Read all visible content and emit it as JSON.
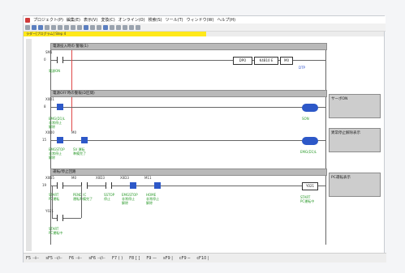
{
  "menubar": {
    "items": [
      "プロジェクト(P)",
      "編集(E)",
      "表示(V)",
      "変換(C)",
      "オンライン(O)",
      "検索(S)",
      "ツール(T)",
      "ウィンドウ(W)",
      "ヘルプ(H)"
    ]
  },
  "tab": {
    "label": "ラダー[プログラム] Step 4"
  },
  "section_headers": [
    "電源投入時の 警報(1)",
    "電源OFF時の警報(D区間)",
    "運転/停止回路"
  ],
  "rung1": {
    "device": "SM1",
    "step": "0",
    "comment": "電源ON",
    "instr_op": "DPO",
    "instr_arg1": "K4B10 E",
    "instr_arg2": "M0",
    "coil_label": "DTP"
  },
  "rung2": {
    "device": "X0D1",
    "step": "8",
    "comment": "EMG(D1)L\n非常停止\n解除",
    "coil_label": "SON",
    "note": "サーボON"
  },
  "rung3": {
    "device1": "X0D0",
    "device2": "M0",
    "step": "15",
    "comment1": "EMGSTOP\n非常停止\n解除",
    "comment2": "SV 運転\n準備完了",
    "coil_label": "EMG(D1)L",
    "note": "異常停止解除表示"
  },
  "rung4": {
    "device1": "X0D5",
    "device2": "M0",
    "device3": "X0D3",
    "device4": "X0D3",
    "device5": "M11",
    "step": "19",
    "coil": "Y021",
    "comment1": "START\nPC運転",
    "comment2": "PEND IC\n運転準備完了",
    "comment3": "SSTOP\n停止",
    "comment4": "EMGSTOP\n非常停止\n解除",
    "comment5": "HOME\n非常停止\n解除",
    "coil_label": "START\nPC運転中",
    "note": "PC運転表示",
    "branch_device": "Y021",
    "branch_comment": "START\nPC運転中"
  },
  "statusbar": {
    "keys": [
      "F5 ⊣⊢",
      "sF5 ⊣/⊢",
      "F6 ⊣⊢",
      "sF6 ⊣/⊢",
      "F7 ( )",
      "F8 [ ]",
      "F9 —",
      "sF9 |",
      "cF9 ─",
      "cF10 |"
    ]
  },
  "colors": {
    "active_contact": "#2d58c8",
    "comment_green": "#2b9a2b",
    "tab_yellow": "#ffe81a",
    "section_gray": "#b9b9b9"
  }
}
